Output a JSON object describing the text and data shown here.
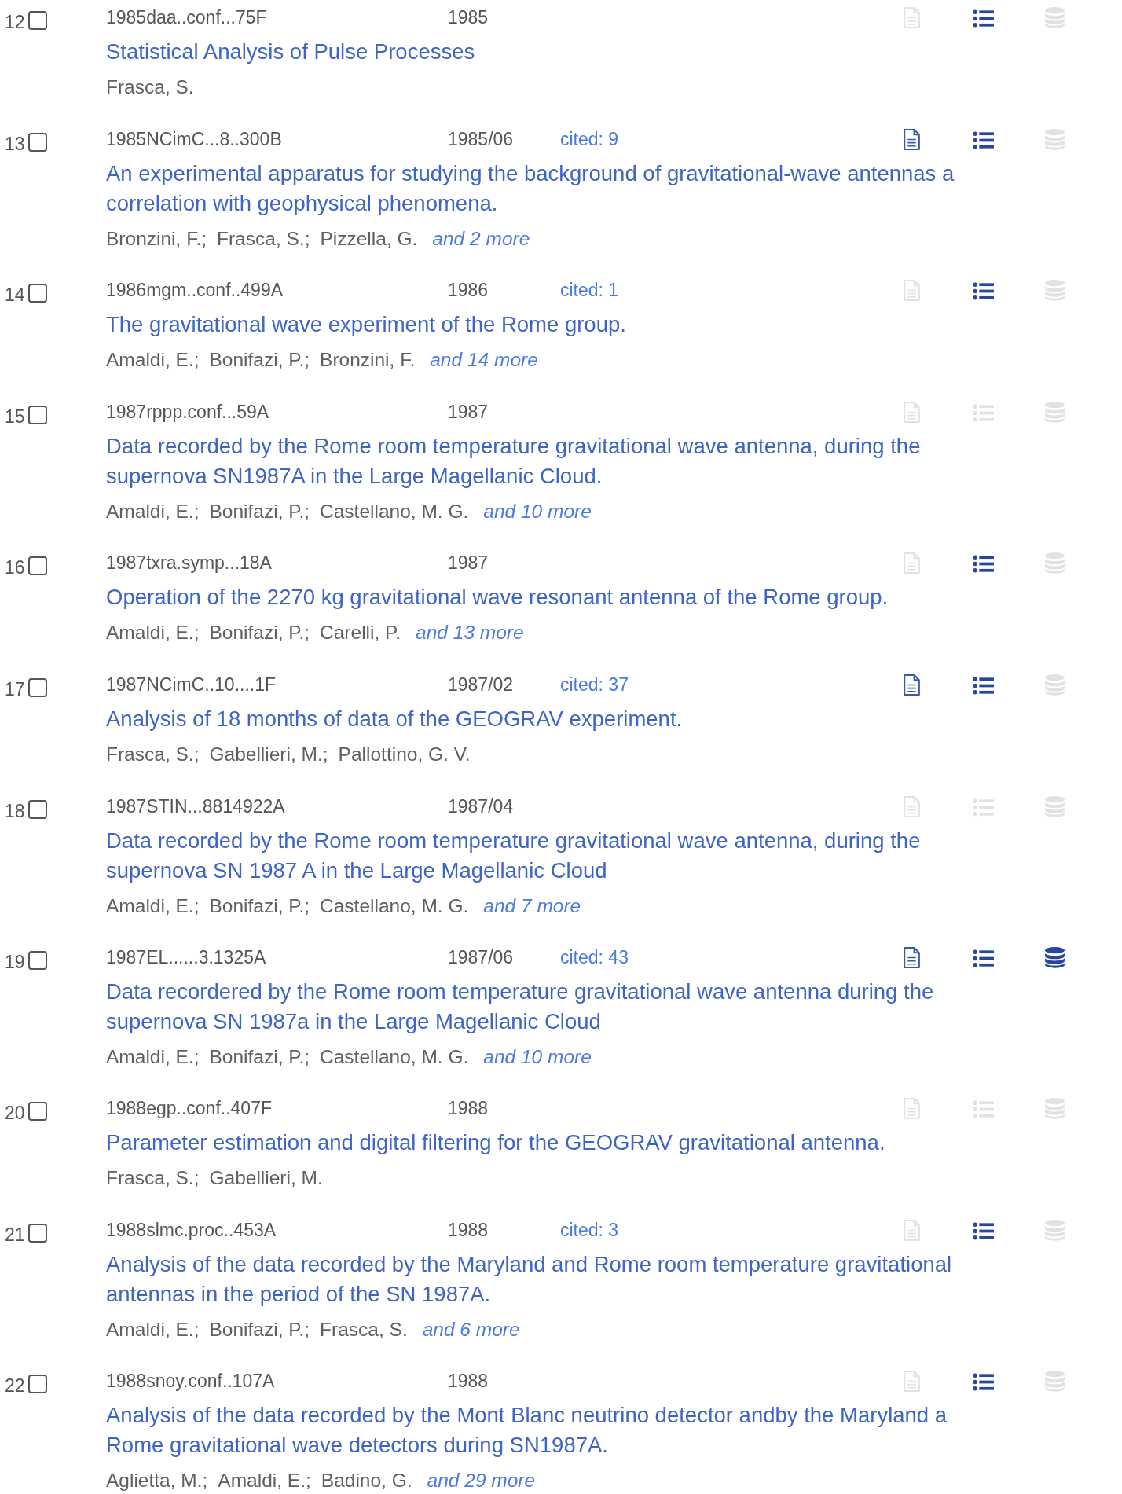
{
  "results": [
    {
      "number": "12",
      "checked": false,
      "bibcode": "1985daa..conf...75F",
      "date": "1985",
      "title_lines": [
        "Statistical Analysis of Pulse Processes"
      ],
      "authors": [
        "Frasca, S."
      ],
      "full_text": false,
      "references": true,
      "data": false
    },
    {
      "number": "13",
      "checked": false,
      "bibcode": "1985NCimC...8..300B",
      "date": "1985/06",
      "cited": "cited: 9",
      "title_lines": [
        "An experimental apparatus for studying the background of gravitational-wave antennas a",
        "correlation with geophysical phenomena."
      ],
      "authors": [
        "Bronzini, F.;",
        "Frasca, S.;",
        "Pizzella, G."
      ],
      "more": "and 2 more",
      "full_text": true,
      "references": true,
      "data": false
    },
    {
      "number": "14",
      "checked": false,
      "bibcode": "1986mgm..conf..499A",
      "date": "1986",
      "cited": "cited: 1",
      "title_lines": [
        "The gravitational wave experiment of the Rome group."
      ],
      "authors": [
        "Amaldi, E.;",
        "Bonifazi, P.;",
        "Bronzini, F."
      ],
      "more": "and 14 more",
      "full_text": false,
      "references": true,
      "data": false
    },
    {
      "number": "15",
      "checked": false,
      "bibcode": "1987rppp.conf...59A",
      "date": "1987",
      "title_lines": [
        "Data recorded by the Rome room temperature gravitational wave antenna, during the",
        "supernova SN1987A in the Large Magellanic Cloud."
      ],
      "authors": [
        "Amaldi, E.;",
        "Bonifazi, P.;",
        "Castellano, M. G."
      ],
      "more": "and 10 more",
      "full_text": false,
      "references": false,
      "data": false
    },
    {
      "number": "16",
      "checked": false,
      "bibcode": "1987txra.symp...18A",
      "date": "1987",
      "title_lines": [
        "Operation of the 2270 kg gravitational wave resonant antenna of the Rome group."
      ],
      "authors": [
        "Amaldi, E.;",
        "Bonifazi, P.;",
        "Carelli, P."
      ],
      "more": "and 13 more",
      "full_text": false,
      "references": true,
      "data": false
    },
    {
      "number": "17",
      "checked": false,
      "bibcode": "1987NCimC..10....1F",
      "date": "1987/02",
      "cited": "cited: 37",
      "title_lines": [
        "Analysis of 18 months of data of the GEOGRAV experiment."
      ],
      "authors": [
        "Frasca, S.;",
        "Gabellieri, M.;",
        "Pallottino, G. V."
      ],
      "full_text": true,
      "references": true,
      "data": false
    },
    {
      "number": "18",
      "checked": false,
      "bibcode": "1987STIN...8814922A",
      "date": "1987/04",
      "title_lines": [
        "Data recorded by the Rome room temperature gravitational wave antenna, during the",
        "supernova SN 1987 A in the Large Magellanic Cloud"
      ],
      "authors": [
        "Amaldi, E.;",
        "Bonifazi, P.;",
        "Castellano, M. G."
      ],
      "more": "and 7 more",
      "full_text": false,
      "references": false,
      "data": false
    },
    {
      "number": "19",
      "checked": false,
      "bibcode": "1987EL......3.1325A",
      "date": "1987/06",
      "cited": "cited: 43",
      "title_lines": [
        "Data recordered by the Rome room temperature gravitational wave antenna during the",
        "supernova SN 1987a in the Large Magellanic Cloud"
      ],
      "authors": [
        "Amaldi, E.;",
        "Bonifazi, P.;",
        "Castellano, M. G."
      ],
      "more": "and 10 more",
      "full_text": true,
      "references": true,
      "data": true
    },
    {
      "number": "20",
      "checked": false,
      "bibcode": "1988egp..conf..407F",
      "date": "1988",
      "title_lines": [
        "Parameter estimation and digital filtering for the GEOGRAV gravitational antenna."
      ],
      "authors": [
        "Frasca, S.;",
        "Gabellieri, M."
      ],
      "full_text": false,
      "references": false,
      "data": false
    },
    {
      "number": "21",
      "checked": false,
      "bibcode": "1988slmc.proc..453A",
      "date": "1988",
      "cited": "cited: 3",
      "title_lines": [
        "Analysis of the data recorded by the Maryland and Rome room temperature gravitational",
        "antennas in the period of the SN 1987A."
      ],
      "authors": [
        "Amaldi, E.;",
        "Bonifazi, P.;",
        "Frasca, S."
      ],
      "more": "and 6 more",
      "full_text": false,
      "references": true,
      "data": false
    },
    {
      "number": "22",
      "checked": false,
      "bibcode": "1988snoy.conf..107A",
      "date": "1988",
      "title_lines": [
        "Analysis of the data recorded by the Mont Blanc neutrino detector andby the Maryland a",
        "Rome gravitational wave detectors during SN1987A."
      ],
      "authors": [
        "Aglietta, M.;",
        "Amaldi, E.;",
        "Badino, G."
      ],
      "more": "and 29 more",
      "full_text": false,
      "references": true,
      "data": false
    }
  ]
}
